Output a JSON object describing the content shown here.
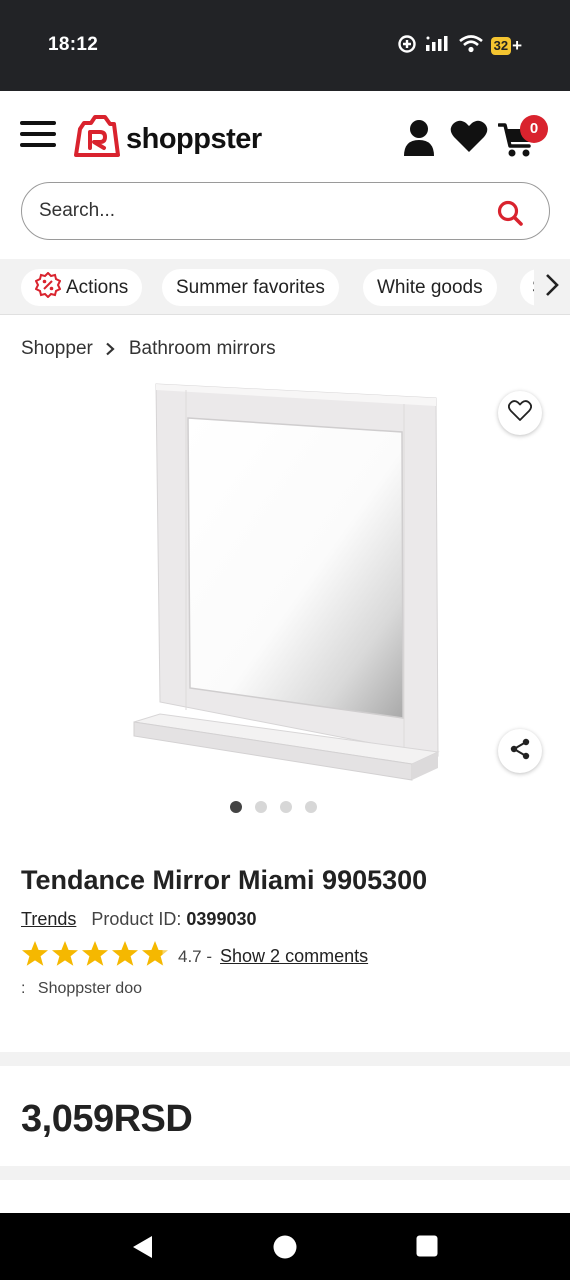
{
  "status_bar": {
    "time": "18:12",
    "battery": "32",
    "battery_suffix": "+",
    "icons": [
      "data-saver-icon",
      "signal-icon",
      "wifi-icon",
      "battery-icon"
    ]
  },
  "header": {
    "logo_text": "shoppster",
    "cart_count": "0",
    "brand_color": "#d9232e",
    "icons": [
      "menu-icon",
      "user-icon",
      "heart-icon",
      "cart-icon"
    ]
  },
  "search": {
    "placeholder": "Search..."
  },
  "categories": [
    {
      "label": "Actions",
      "icon": "discount-icon"
    },
    {
      "label": "Summer favorites"
    },
    {
      "label": "White goods"
    },
    {
      "label": "S"
    }
  ],
  "breadcrumb": {
    "root": "Shopper",
    "current": "Bathroom mirrors"
  },
  "gallery": {
    "image_count": 4,
    "active_index": 0
  },
  "product": {
    "title": "Tendance Mirror Miami 9905300",
    "brand": "Trends",
    "product_id_label": "Product ID:",
    "product_id": "0399030",
    "rating_value": 4.7,
    "rating_text": "4.7 -",
    "comments_link": "Show 2 comments",
    "seller_prefix": ":",
    "seller": "Shoppster doo",
    "price": "3,059RSD"
  },
  "colors": {
    "accent": "#d9232e",
    "star": "#f5b800",
    "status_bar": "#222326",
    "nav_bar": "#000000"
  }
}
